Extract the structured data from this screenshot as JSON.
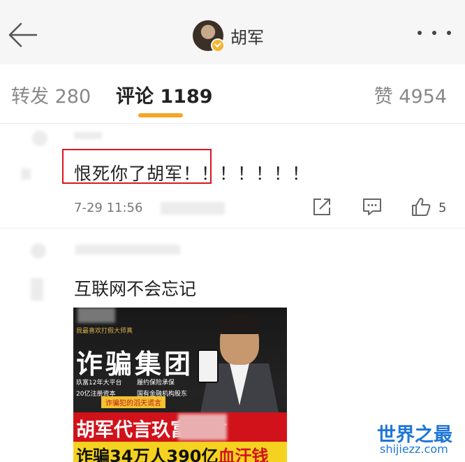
{
  "header": {
    "title": "胡军",
    "back_icon": "arrow-left-icon",
    "more_icon": "more-dots-icon"
  },
  "tabs": [
    {
      "label": "转发 280",
      "active": false
    },
    {
      "label": "评论 1189",
      "active": true
    },
    {
      "label": "赞 4954",
      "active": false
    }
  ],
  "comments": [
    {
      "text": "恨死你了胡军！！！！！！！",
      "time": "7-29 11:56",
      "like_count": "5",
      "highlight_color": "#d9161f"
    },
    {
      "text": "互联网不会忘记",
      "image": {
        "top_text": "我最喜欢打假大师真",
        "headline": "诈骗集团",
        "bullets": [
          "玖富12年大平台",
          "履约保险承保",
          "20亿注册资本",
          "国有金融机构股东"
        ],
        "strip": "诈骗犯的滔天谎言",
        "main_line": "胡军代言玖富理财",
        "sub_line_black": "诈骗34万人390亿",
        "sub_line_red": "血汗钱"
      }
    }
  ],
  "watermark": {
    "main": "世界之最",
    "sub": "shijiezz.com",
    "color": "#1e77d8"
  },
  "colors": {
    "accent": "#f5a623",
    "badge": "#f2b531"
  }
}
